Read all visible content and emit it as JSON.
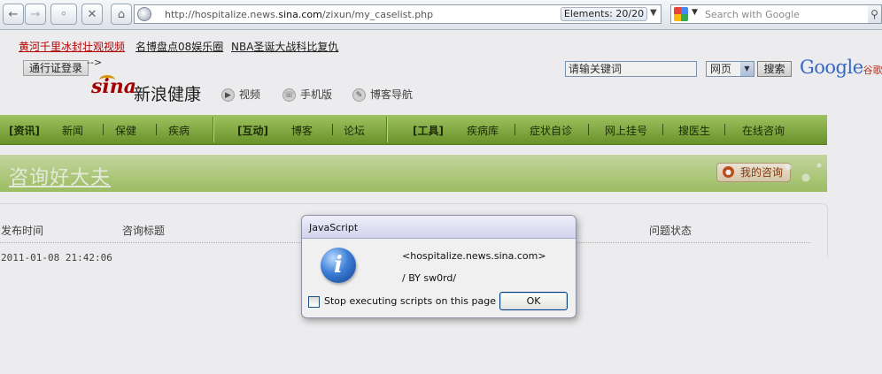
{
  "browser": {
    "url_prefix": "http://hospitalize.news.",
    "url_host": "sina.com",
    "url_path": "/zixun/my_caselist.php",
    "elements_label": "Elements:  20/20",
    "search_placeholder": "Search with Google",
    "icons": [
      "back-icon",
      "forward-icon",
      "keyhole-icon",
      "stop-icon",
      "home-icon",
      "globe-icon",
      "google-icon",
      "search-icon"
    ]
  },
  "page": {
    "top_links": [
      "黄河千里冰封壮观视频",
      "名博盘点08娱乐圈",
      "NBA圣诞大战科比复仇"
    ],
    "pass_button": "通行证登录",
    "arrow_mark": "-->",
    "search_input": "请输关键词",
    "search_select": "网页",
    "search_button": "搜索",
    "google_logo": "Google",
    "google_cn": "谷歌",
    "sina_logo": "sina",
    "site_title": "新浪健康",
    "quick_links": [
      "视频",
      "手机版",
      "博客导航"
    ],
    "nav": [
      "[资讯]",
      "新闻",
      "保健",
      "疾病",
      "[互动]",
      "博客",
      "论坛",
      "[工具]",
      "疾病库",
      "症状自诊",
      "网上挂号",
      "搜医生",
      "在线咨询"
    ],
    "banner_title": "咨询好大夫",
    "my_consult": "我的咨询",
    "columns": [
      "发布时间",
      "咨询标题",
      "问题状态"
    ],
    "row_date": "2011-01-08 21:42:06"
  },
  "dialog": {
    "title": "JavaScript",
    "line1": "<hospitalize.news.sina.com>",
    "line2": "/ BY sw0rd/",
    "checkbox_label": "Stop executing scripts on this page",
    "ok": "OK"
  },
  "colors": {
    "nav_green": "#8ab848",
    "banner_green": "#b9d585",
    "link_red": "#c00000",
    "dialog_bg": "#f0f0f0"
  }
}
